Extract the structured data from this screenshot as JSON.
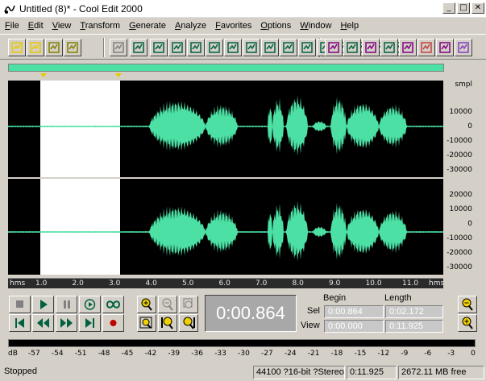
{
  "window": {
    "title": "Untitled (8)* - Cool Edit 2000",
    "minimize": "_",
    "maximize": "□",
    "close": "✕"
  },
  "menu": [
    "File",
    "Edit",
    "View",
    "Transform",
    "Generate",
    "Analyze",
    "Favorites",
    "Options",
    "Window",
    "Help"
  ],
  "toolbar": {
    "buttons": [
      "new-file-icon",
      "open-file-icon",
      "save-icon",
      "save-all-icon",
      "undo-icon",
      "loop-icon",
      "cut-icon",
      "trim-icon",
      "copy-icon",
      "paste-icon",
      "cut-scissors-icon",
      "mix-paste-icon",
      "analyze-icon",
      "envelope-icon",
      "effects-icon",
      "reverse-icon",
      "stretch-icon",
      "silence-icon",
      "noise-icon",
      "favorites-icon",
      "checkbox-icon",
      "grid-icon",
      "frequency-icon",
      "spectrum-icon",
      "meter-icon",
      "query-icon",
      "paste-special-icon",
      "cd-icon"
    ]
  },
  "colors": {
    "waveform": "#4ce0a4",
    "background": "#000000",
    "selection": "#ffffff",
    "window_bg": "#d4d0c8"
  },
  "ruler": {
    "unit": "smpl",
    "top_labels": [
      "10000",
      "0",
      "-10000",
      "-20000",
      "-30000"
    ],
    "bottom_labels": [
      "20000",
      "10000",
      "0",
      "-10000",
      "-20000",
      "-30000"
    ]
  },
  "time_ruler": {
    "start_label": "hms",
    "end_label": "hms",
    "ticks": [
      "1.0",
      "2.0",
      "3.0",
      "4.0",
      "5.0",
      "6.0",
      "7.0",
      "8.0",
      "9.0",
      "10.0",
      "11.0"
    ]
  },
  "time_display": "0:00.864",
  "selection": {
    "begin_header": "Begin",
    "length_header": "Length",
    "sel_label": "Sel",
    "view_label": "View",
    "sel_begin": "0:00.864",
    "sel_length": "0:02.172",
    "view_begin": "0:00.000",
    "view_length": "0:11.925"
  },
  "level_meter": {
    "unit": "dB",
    "labels": [
      "-57",
      "-54",
      "-51",
      "-48",
      "-45",
      "-42",
      "-39",
      "-36",
      "-33",
      "-30",
      "-27",
      "-24",
      "-21",
      "-18",
      "-15",
      "-12",
      "-9",
      "-6",
      "-3",
      "0"
    ]
  },
  "status": {
    "state": "Stopped",
    "format": "44100 ?16-bit ?Stereo",
    "duration": "0:11.925",
    "free_space": "2672.11 MB free"
  }
}
